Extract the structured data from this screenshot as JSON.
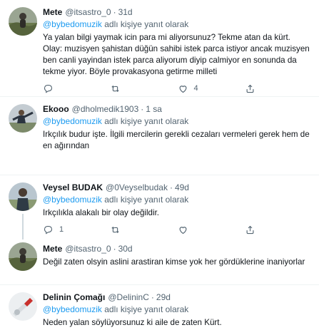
{
  "reply_prefix": "adlı kişiye yanıt olarak",
  "tweets": [
    {
      "name": "Mete",
      "handle": "@itsastro_0",
      "dot": "·",
      "time": "31d",
      "reply_to": "@bybedomuzik",
      "text": "Ya yalan bilgi yaymak icin para mi aliyorsunuz? Tekme atan da kürt. Olay: muzisyen şahistan düğün sahibi istek parca istiyor ancak muzisyen ben canli yayindan istek parca aliyorum diyip calmiyor en sonunda da tekme yiyor. Böyle provakasyona getirme milleti",
      "counts": {
        "reply": "",
        "retweet": "",
        "like": "4"
      }
    },
    {
      "name": "Ekooo",
      "handle": "@dholmedik1903",
      "dot": "·",
      "time": "1 sa",
      "reply_to": "@bybedomuzik",
      "text": "Irkçılık budur işte. İlgili mercilerin gerekli cezaları vermeleri gerek hem de en ağırından",
      "counts": null
    },
    {
      "name": "Veysel BUDAK",
      "handle": "@0Veyselbudak",
      "dot": "·",
      "time": "49d",
      "reply_to": "@bybedomuzik",
      "text": "Irkçılıkla alakalı bir olay değildir.",
      "counts": {
        "reply": "1",
        "retweet": "",
        "like": ""
      }
    },
    {
      "name": "Mete",
      "handle": "@itsastro_0",
      "dot": "·",
      "time": "30d",
      "reply_to": "",
      "text": "Değil zaten olsyin aslini arastiran kimse yok her gördüklerine inaniyorlar",
      "counts": null
    },
    {
      "name": "Delinin Çomağı",
      "handle": "@DelininC",
      "dot": "·",
      "time": "29d",
      "reply_to": "@bybedomuzik",
      "text": "Neden yalan söylüyorsunuz ki aile de zaten Kürt.",
      "counts": null
    }
  ],
  "colors": {
    "accent": "#1d9bf0",
    "text": "#0f1419",
    "secondary": "#536471",
    "divider": "#eff3f4"
  },
  "icons": [
    "reply-icon",
    "retweet-icon",
    "like-icon",
    "share-icon",
    "more-icon"
  ]
}
